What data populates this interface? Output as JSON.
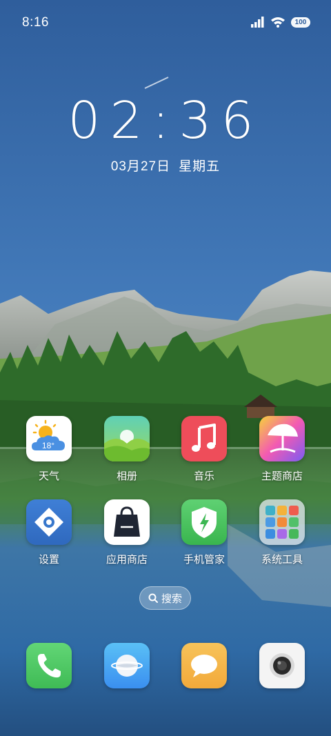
{
  "status_bar": {
    "time": "8:16",
    "battery": "100",
    "icons": [
      "signal-icon",
      "wifi-icon",
      "battery-icon"
    ]
  },
  "lockclock": {
    "time": "02:36",
    "date": "03月27日",
    "weekday": "星期五"
  },
  "apps": [
    {
      "label": "天气",
      "icon": "weather-icon",
      "temp": "18°"
    },
    {
      "label": "相册",
      "icon": "gallery-icon"
    },
    {
      "label": "音乐",
      "icon": "music-icon"
    },
    {
      "label": "主题商店",
      "icon": "theme-store-icon"
    },
    {
      "label": "设置",
      "icon": "settings-icon"
    },
    {
      "label": "应用商店",
      "icon": "app-store-icon"
    },
    {
      "label": "手机管家",
      "icon": "phone-manager-icon"
    },
    {
      "label": "系统工具",
      "icon": "system-tools-folder-icon"
    }
  ],
  "search": {
    "label": "搜索"
  },
  "dock": [
    {
      "icon": "phone-icon"
    },
    {
      "icon": "browser-icon"
    },
    {
      "icon": "messages-icon"
    },
    {
      "icon": "camera-icon"
    }
  ],
  "colors": {
    "sky_top": "#2f5e9c",
    "sky_bottom": "#5a95cf",
    "forest": "#2e6b2a",
    "lake": "#2a5d8e"
  }
}
